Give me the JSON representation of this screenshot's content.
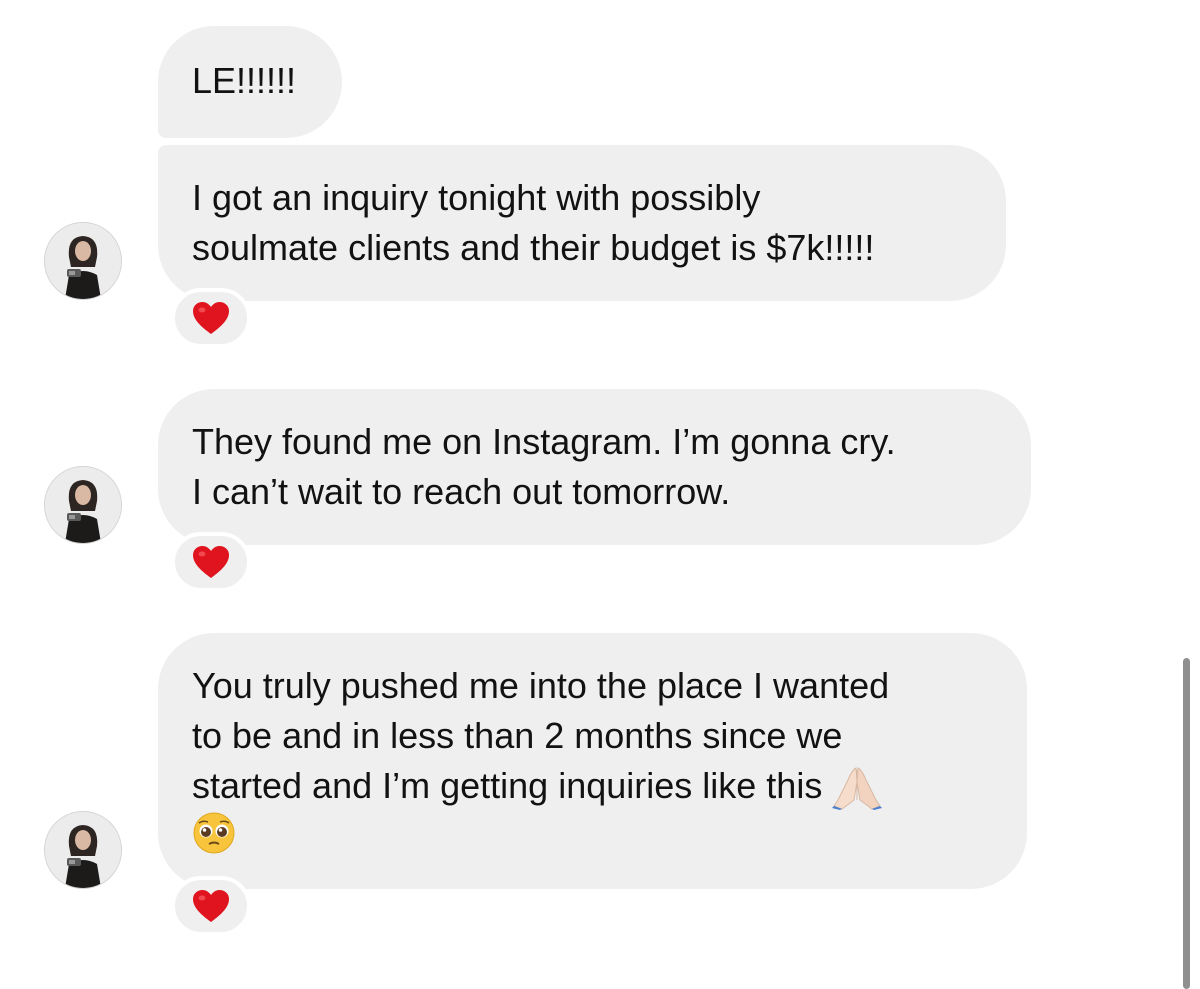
{
  "messages": [
    {
      "lines": [
        "LE!!!!!!"
      ],
      "reaction": "red-heart",
      "has_avatar": false
    },
    {
      "lines": [
        "I got an inquiry tonight with possibly",
        "soulmate clients and their budget is $7k!!!!!"
      ],
      "reaction": "red-heart",
      "has_avatar": true
    },
    {
      "lines": [
        "They found me on Instagram. I’m gonna cry.",
        "I can’t wait to reach out tomorrow."
      ],
      "reaction": "red-heart",
      "has_avatar": true
    },
    {
      "lines": [
        "You truly pushed me into the place I wanted",
        "to be and in less than 2 months since we",
        "started and I’m getting inquiries like this"
      ],
      "inline_emoji": [
        "folded-hands",
        "pleading-face"
      ],
      "reaction": "red-heart",
      "has_avatar": true
    }
  ],
  "colors": {
    "bubble": "#efefef",
    "heart": "#e0141e",
    "background": "#ffffff",
    "scrollbar": "#8f8f8f"
  }
}
